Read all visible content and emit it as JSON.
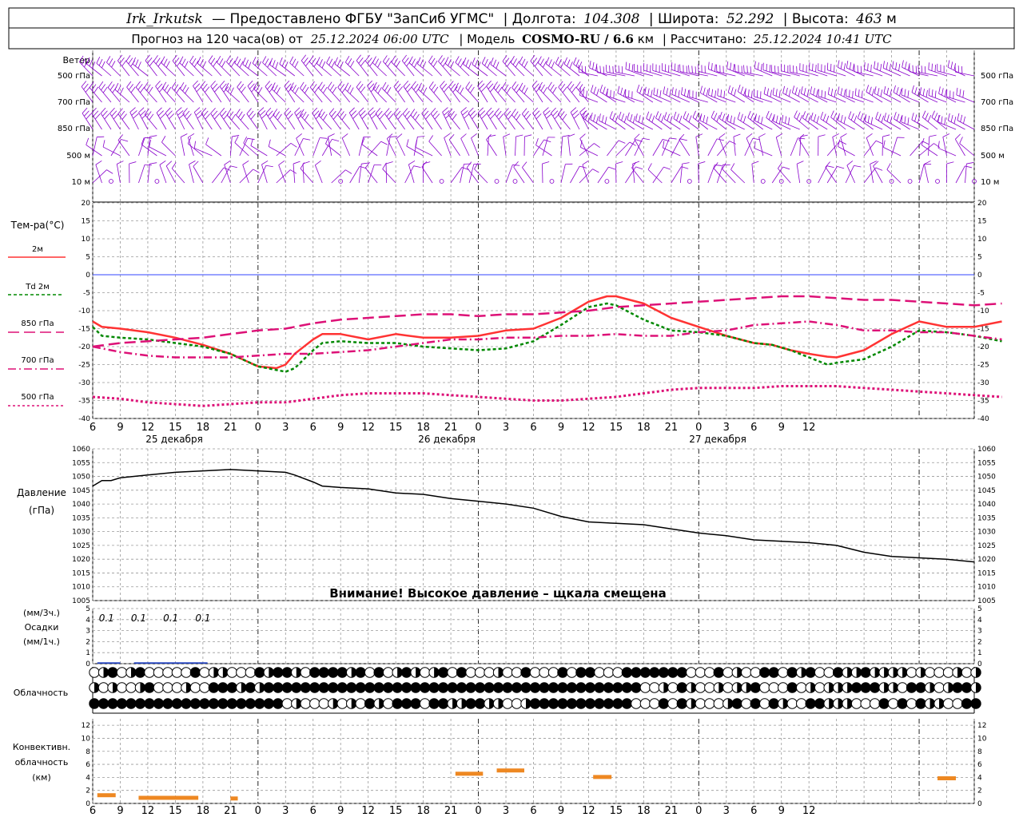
{
  "header": {
    "station": "Irk_Irkutsk",
    "provided": "— Предоставлено ФГБУ \"ЗапСиб УГМС\"",
    "lon_label": "| Долгота:",
    "lon_value": "104.308",
    "lat_label": "| Широта:",
    "lat_value": "52.292",
    "alt_label": "| Высота:",
    "alt_value": "463",
    "alt_unit": "м",
    "forecast_label": "Прогноз на 120 часа(ов) от",
    "forecast_time": "25.12.2024 06:00 UTC",
    "model_label": "| Модель",
    "model_name": "COSMO-RU / 6.6",
    "model_unit": "км",
    "calc_label": "| Рассчитано:",
    "calc_time": "25.12.2024 10:41 UTC"
  },
  "labels": {
    "wind": "Ветер",
    "temp": "Тем-ра(°C)",
    "pressure1": "Давление",
    "pressure2": "(гПа)",
    "precip1": "(мм/3ч.)",
    "precip2": "Осадки",
    "precip3": "(мм/1ч.)",
    "cloud": "Облачность",
    "conv1": "Конвективн.",
    "conv2": "облачность",
    "conv3": "(км)",
    "warning": "Внимание! Высокое давление – щкала смещена",
    "wind_levels": [
      "500 гПа",
      "700 гПа",
      "850 гПа",
      "500 м",
      "10 м"
    ],
    "legend": [
      "2м",
      "Td  2м",
      "850 гПа",
      "700 гПа",
      "500 гПа"
    ],
    "dates": [
      "25 декабря",
      "26 декабря",
      "27 декабря"
    ]
  },
  "colors": {
    "t2m": "#ff3333",
    "td2m": "#008800",
    "t850": "#dd1177",
    "t700": "#dd1177",
    "t500": "#dd1177",
    "wind": "#8800cc",
    "conv": "#ee8822",
    "grid": "#999999",
    "zero": "#3344ff"
  },
  "chart_data": [
    {
      "type": "line",
      "title": "Тем-ра(°C)",
      "ylim": [
        -40,
        20
      ],
      "yticks": [
        -40,
        -35,
        -30,
        -25,
        -20,
        -15,
        -10,
        -5,
        0,
        5,
        10,
        15,
        20
      ],
      "xlabel": "",
      "x_hours": [
        6,
        9,
        12,
        15,
        18,
        21,
        24,
        27,
        30,
        33,
        36,
        39,
        42,
        45,
        48,
        51,
        54,
        57,
        60,
        63,
        66,
        69,
        72,
        75,
        78,
        81,
        84
      ],
      "x_tick_labels": [
        "6",
        "9",
        "12",
        "15",
        "18",
        "21",
        "0",
        "3",
        "6",
        "9",
        "12",
        "15",
        "18",
        "21",
        "0",
        "3",
        "6",
        "9",
        "12",
        "15",
        "18",
        "21",
        "0",
        "3",
        "6",
        "9",
        "12"
      ],
      "series": [
        {
          "name": "2м",
          "key": "t2m",
          "dash": "",
          "width": 2.5,
          "points": [
            [
              6,
              -13
            ],
            [
              7,
              -14.5
            ],
            [
              9,
              -15
            ],
            [
              12,
              -16
            ],
            [
              15,
              -17.5
            ],
            [
              18,
              -19.5
            ],
            [
              21,
              -22
            ],
            [
              24,
              -25.5
            ],
            [
              26,
              -26
            ],
            [
              27,
              -25
            ],
            [
              28,
              -22
            ],
            [
              30,
              -18
            ],
            [
              31,
              -16.5
            ],
            [
              33,
              -16.5
            ],
            [
              36,
              -18
            ],
            [
              39,
              -16.5
            ],
            [
              42,
              -17.5
            ],
            [
              45,
              -17.5
            ],
            [
              48,
              -17
            ],
            [
              51,
              -15.5
            ],
            [
              54,
              -15
            ],
            [
              57,
              -12
            ],
            [
              60,
              -7.5
            ],
            [
              62,
              -6
            ],
            [
              63,
              -6
            ],
            [
              66,
              -8
            ],
            [
              69,
              -12
            ],
            [
              72,
              -14.5
            ],
            [
              75,
              -17
            ],
            [
              78,
              -19
            ],
            [
              80,
              -19.5
            ],
            [
              82,
              -21
            ],
            [
              84,
              -22
            ],
            [
              86,
              -22.8
            ],
            [
              87,
              -23
            ],
            [
              90,
              -21
            ],
            [
              93,
              -16.5
            ],
            [
              96,
              -13
            ],
            [
              99,
              -14.5
            ],
            [
              102,
              -14.5
            ],
            [
              105,
              -13
            ]
          ]
        },
        {
          "name": "Td  2м",
          "key": "td2m",
          "dash": "4,3",
          "width": 2.5,
          "points": [
            [
              6,
              -14.5
            ],
            [
              7,
              -17
            ],
            [
              9,
              -17.5
            ],
            [
              12,
              -18
            ],
            [
              15,
              -19
            ],
            [
              18,
              -20
            ],
            [
              21,
              -22
            ],
            [
              24,
              -25.5
            ],
            [
              27,
              -27
            ],
            [
              28,
              -26
            ],
            [
              30,
              -21
            ],
            [
              31,
              -19
            ],
            [
              33,
              -18.5
            ],
            [
              36,
              -19
            ],
            [
              39,
              -19
            ],
            [
              42,
              -20
            ],
            [
              45,
              -20.5
            ],
            [
              48,
              -21
            ],
            [
              51,
              -20.5
            ],
            [
              54,
              -18.5
            ],
            [
              57,
              -14
            ],
            [
              60,
              -9
            ],
            [
              62,
              -8
            ],
            [
              63,
              -8.5
            ],
            [
              66,
              -12.5
            ],
            [
              69,
              -15.5
            ],
            [
              72,
              -16
            ],
            [
              75,
              -17
            ],
            [
              78,
              -19
            ],
            [
              80,
              -19.5
            ],
            [
              82,
              -21
            ],
            [
              84,
              -23
            ],
            [
              86,
              -25
            ],
            [
              87,
              -24.5
            ],
            [
              90,
              -23.5
            ],
            [
              93,
              -20
            ],
            [
              96,
              -15.5
            ],
            [
              99,
              -16
            ],
            [
              102,
              -17
            ],
            [
              105,
              -18.5
            ]
          ]
        },
        {
          "name": "850 гПа",
          "key": "t850",
          "dash": "14,6",
          "width": 2.5,
          "points": [
            [
              6,
              -20
            ],
            [
              9,
              -19
            ],
            [
              12,
              -18.5
            ],
            [
              15,
              -18
            ],
            [
              18,
              -17.5
            ],
            [
              21,
              -16.5
            ],
            [
              24,
              -15.5
            ],
            [
              27,
              -15
            ],
            [
              30,
              -13.5
            ],
            [
              33,
              -12.5
            ],
            [
              36,
              -12
            ],
            [
              39,
              -11.5
            ],
            [
              42,
              -11
            ],
            [
              45,
              -11
            ],
            [
              48,
              -11.5
            ],
            [
              51,
              -11
            ],
            [
              54,
              -11
            ],
            [
              57,
              -10.5
            ],
            [
              60,
              -10
            ],
            [
              63,
              -9
            ],
            [
              66,
              -8.5
            ],
            [
              69,
              -8
            ],
            [
              72,
              -7.5
            ],
            [
              75,
              -7
            ],
            [
              78,
              -6.5
            ],
            [
              81,
              -6
            ],
            [
              84,
              -6
            ],
            [
              87,
              -6.5
            ],
            [
              90,
              -7
            ],
            [
              93,
              -7
            ],
            [
              96,
              -7.5
            ],
            [
              99,
              -8
            ],
            [
              102,
              -8.5
            ],
            [
              105,
              -8
            ]
          ]
        },
        {
          "name": "700 гПа",
          "key": "t700",
          "dash": "10,4,2,4",
          "width": 2.5,
          "points": [
            [
              6,
              -20
            ],
            [
              9,
              -21.5
            ],
            [
              12,
              -22.5
            ],
            [
              15,
              -23
            ],
            [
              18,
              -23
            ],
            [
              21,
              -23
            ],
            [
              24,
              -22.5
            ],
            [
              27,
              -22
            ],
            [
              30,
              -22
            ],
            [
              33,
              -21.5
            ],
            [
              36,
              -21
            ],
            [
              39,
              -20
            ],
            [
              42,
              -19
            ],
            [
              45,
              -18
            ],
            [
              48,
              -18
            ],
            [
              51,
              -17.5
            ],
            [
              54,
              -17.5
            ],
            [
              57,
              -17
            ],
            [
              60,
              -17
            ],
            [
              63,
              -16.5
            ],
            [
              66,
              -17
            ],
            [
              69,
              -17
            ],
            [
              72,
              -16
            ],
            [
              75,
              -15.5
            ],
            [
              78,
              -14
            ],
            [
              81,
              -13.5
            ],
            [
              84,
              -13
            ],
            [
              87,
              -14
            ],
            [
              90,
              -15.5
            ],
            [
              93,
              -15.5
            ],
            [
              96,
              -16
            ],
            [
              99,
              -16
            ],
            [
              102,
              -17
            ],
            [
              105,
              -18
            ]
          ]
        },
        {
          "name": "500 гПа",
          "key": "t500",
          "dash": "3,3",
          "width": 3,
          "points": [
            [
              6,
              -34
            ],
            [
              9,
              -34.5
            ],
            [
              12,
              -35.5
            ],
            [
              15,
              -36
            ],
            [
              18,
              -36.5
            ],
            [
              21,
              -36
            ],
            [
              24,
              -35.5
            ],
            [
              27,
              -35.5
            ],
            [
              30,
              -34.5
            ],
            [
              33,
              -33.5
            ],
            [
              36,
              -33
            ],
            [
              39,
              -33
            ],
            [
              42,
              -33
            ],
            [
              45,
              -33.5
            ],
            [
              48,
              -34
            ],
            [
              51,
              -34.5
            ],
            [
              54,
              -35
            ],
            [
              57,
              -35
            ],
            [
              60,
              -34.5
            ],
            [
              63,
              -34
            ],
            [
              66,
              -33
            ],
            [
              69,
              -32
            ],
            [
              72,
              -31.5
            ],
            [
              75,
              -31.5
            ],
            [
              78,
              -31.5
            ],
            [
              81,
              -31
            ],
            [
              84,
              -31
            ],
            [
              87,
              -31
            ],
            [
              90,
              -31.5
            ],
            [
              93,
              -32
            ],
            [
              96,
              -32.5
            ],
            [
              99,
              -33
            ],
            [
              102,
              -33.5
            ],
            [
              105,
              -34
            ]
          ]
        }
      ]
    },
    {
      "type": "line",
      "title": "Давление",
      "ylabel": "(гПа)",
      "ylim": [
        1005,
        1060
      ],
      "yticks": [
        1005,
        1010,
        1015,
        1020,
        1025,
        1030,
        1035,
        1040,
        1045,
        1050,
        1055,
        1060
      ],
      "series": [
        {
          "name": "",
          "points": [
            [
              6,
              1046.5
            ],
            [
              7,
              1048.5
            ],
            [
              8,
              1048.5
            ],
            [
              9,
              1049.5
            ],
            [
              12,
              1050.5
            ],
            [
              15,
              1051.5
            ],
            [
              18,
              1052
            ],
            [
              21,
              1052.5
            ],
            [
              24,
              1052
            ],
            [
              27,
              1051.5
            ],
            [
              28,
              1050.5
            ],
            [
              30,
              1048
            ],
            [
              31,
              1046.5
            ],
            [
              33,
              1046
            ],
            [
              36,
              1045.5
            ],
            [
              39,
              1044
            ],
            [
              42,
              1043.5
            ],
            [
              45,
              1042
            ],
            [
              48,
              1041
            ],
            [
              51,
              1040
            ],
            [
              54,
              1038.5
            ],
            [
              57,
              1035.5
            ],
            [
              60,
              1033.5
            ],
            [
              63,
              1033
            ],
            [
              66,
              1032.5
            ],
            [
              69,
              1031
            ],
            [
              72,
              1029.5
            ],
            [
              75,
              1028.5
            ],
            [
              78,
              1027
            ],
            [
              81,
              1026.5
            ],
            [
              84,
              1026
            ],
            [
              87,
              1025
            ],
            [
              90,
              1022.5
            ],
            [
              93,
              1021
            ],
            [
              96,
              1020.5
            ],
            [
              99,
              1020
            ],
            [
              102,
              1019
            ]
          ]
        }
      ]
    },
    {
      "type": "bar",
      "title": "Осадки",
      "ylim": [
        0,
        5
      ],
      "yticks": [
        0,
        1,
        2,
        3,
        4,
        5
      ],
      "labels": [
        {
          "x": 7.5,
          "text": "0.1"
        },
        {
          "x": 11,
          "text": "0.1"
        },
        {
          "x": 14.5,
          "text": "0.1"
        },
        {
          "x": 18,
          "text": "0.1"
        }
      ],
      "values": [
        {
          "x0": 6.5,
          "x1": 9,
          "v": 0.05
        },
        {
          "x0": 10.5,
          "x1": 17.5,
          "v": 0.05
        },
        {
          "x0": 17.5,
          "x1": 18.5,
          "v": 0.05
        }
      ]
    },
    {
      "type": "bar",
      "title": "Конвективн. облачность",
      "ylabel": "(км)",
      "ylim": [
        0,
        13
      ],
      "yticks": [
        0,
        2,
        4,
        6,
        8,
        10,
        12
      ],
      "values": [
        {
          "x0": 6.5,
          "x1": 8.5,
          "v": 1.2
        },
        {
          "x0": 11,
          "x1": 17.5,
          "v": 0.8
        },
        {
          "x0": 21,
          "x1": 21.8,
          "v": 0.7
        },
        {
          "x0": 45.5,
          "x1": 48.5,
          "v": 4.5
        },
        {
          "x0": 50,
          "x1": 53,
          "v": 5
        },
        {
          "x0": 60.5,
          "x1": 62.5,
          "v": 4
        },
        {
          "x0": 98,
          "x1": 100,
          "v": 3.8
        }
      ]
    }
  ]
}
